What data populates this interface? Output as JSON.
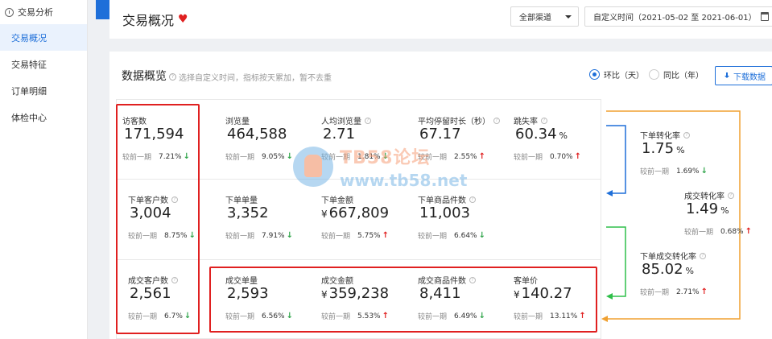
{
  "sidebar": {
    "section": "交易分析",
    "items": [
      {
        "label": "交易概况",
        "active": true
      },
      {
        "label": "交易特征",
        "active": false
      },
      {
        "label": "订单明细",
        "active": false
      },
      {
        "label": "体检中心",
        "active": false
      }
    ]
  },
  "header": {
    "title": "交易概况",
    "channel": "全部渠道",
    "date_range": "自定义时间（2021-05-02 至 2021-06-01）"
  },
  "overview": {
    "title": "数据概览",
    "hint": "选择自定义时间，指标按天累加，暂不去重",
    "radio_mom": "环比（天）",
    "radio_yoy": "同比（年）",
    "download": "下载数据"
  },
  "compare_label": "较前一期",
  "metrics": {
    "visitors": {
      "label": "访客数",
      "value": "171,594",
      "pct": "7.21%",
      "trend": "down"
    },
    "pageviews": {
      "label": "浏览量",
      "value": "464,588",
      "pct": "9.05%",
      "trend": "down"
    },
    "pv_per_user": {
      "label": "人均浏览量",
      "value": "2.71",
      "pct": "1.81%",
      "trend": "down"
    },
    "avg_stay": {
      "label": "平均停留时长（秒）",
      "value": "67.17",
      "pct": "2.55%",
      "trend": "up"
    },
    "bounce": {
      "label": "跳失率",
      "value": "60.34",
      "unit": "%",
      "pct": "0.70%",
      "trend": "up"
    },
    "order_customers": {
      "label": "下单客户数",
      "value": "3,004",
      "pct": "8.75%",
      "trend": "down"
    },
    "order_count": {
      "label": "下单单量",
      "value": "3,352",
      "pct": "7.91%",
      "trend": "down"
    },
    "order_amount": {
      "label": "下单金额",
      "prefix": "¥",
      "value": "667,809",
      "pct": "5.75%",
      "trend": "up"
    },
    "order_items": {
      "label": "下单商品件数",
      "value": "11,003",
      "pct": "6.64%",
      "trend": "down"
    },
    "deal_customers": {
      "label": "成交客户数",
      "value": "2,561",
      "pct": "6.7%",
      "trend": "down"
    },
    "deal_count": {
      "label": "成交单量",
      "value": "2,593",
      "pct": "6.56%",
      "trend": "down"
    },
    "deal_amount": {
      "label": "成交金额",
      "prefix": "¥",
      "value": "359,238",
      "pct": "5.53%",
      "trend": "up"
    },
    "deal_items": {
      "label": "成交商品件数",
      "value": "8,411",
      "pct": "6.49%",
      "trend": "down"
    },
    "unit_price": {
      "label": "客单价",
      "prefix": "¥",
      "value": "140.27",
      "pct": "13.11%",
      "trend": "up"
    },
    "order_conv": {
      "label": "下单转化率",
      "value": "1.75",
      "unit": "%",
      "pct": "1.69%",
      "trend": "down"
    },
    "deal_conv": {
      "label": "成交转化率",
      "value": "1.49",
      "unit": "%",
      "pct": "0.68%",
      "trend": "up"
    },
    "order_deal_conv": {
      "label": "下单成交转化率",
      "value": "85.02",
      "unit": "%",
      "pct": "2.71%",
      "trend": "up"
    }
  },
  "watermark": {
    "line1": "TB58论坛",
    "line2": "www.tb58.net"
  },
  "colors": {
    "accent": "#1e6fd9",
    "up": "#e02020",
    "down": "#2fa44a",
    "flow_orange": "#f0a030",
    "flow_blue": "#1e6fd9",
    "flow_green": "#2fbf4a"
  },
  "arrows": {
    "up": "↑",
    "down": "↓"
  },
  "icons": {
    "heart": "♥"
  }
}
